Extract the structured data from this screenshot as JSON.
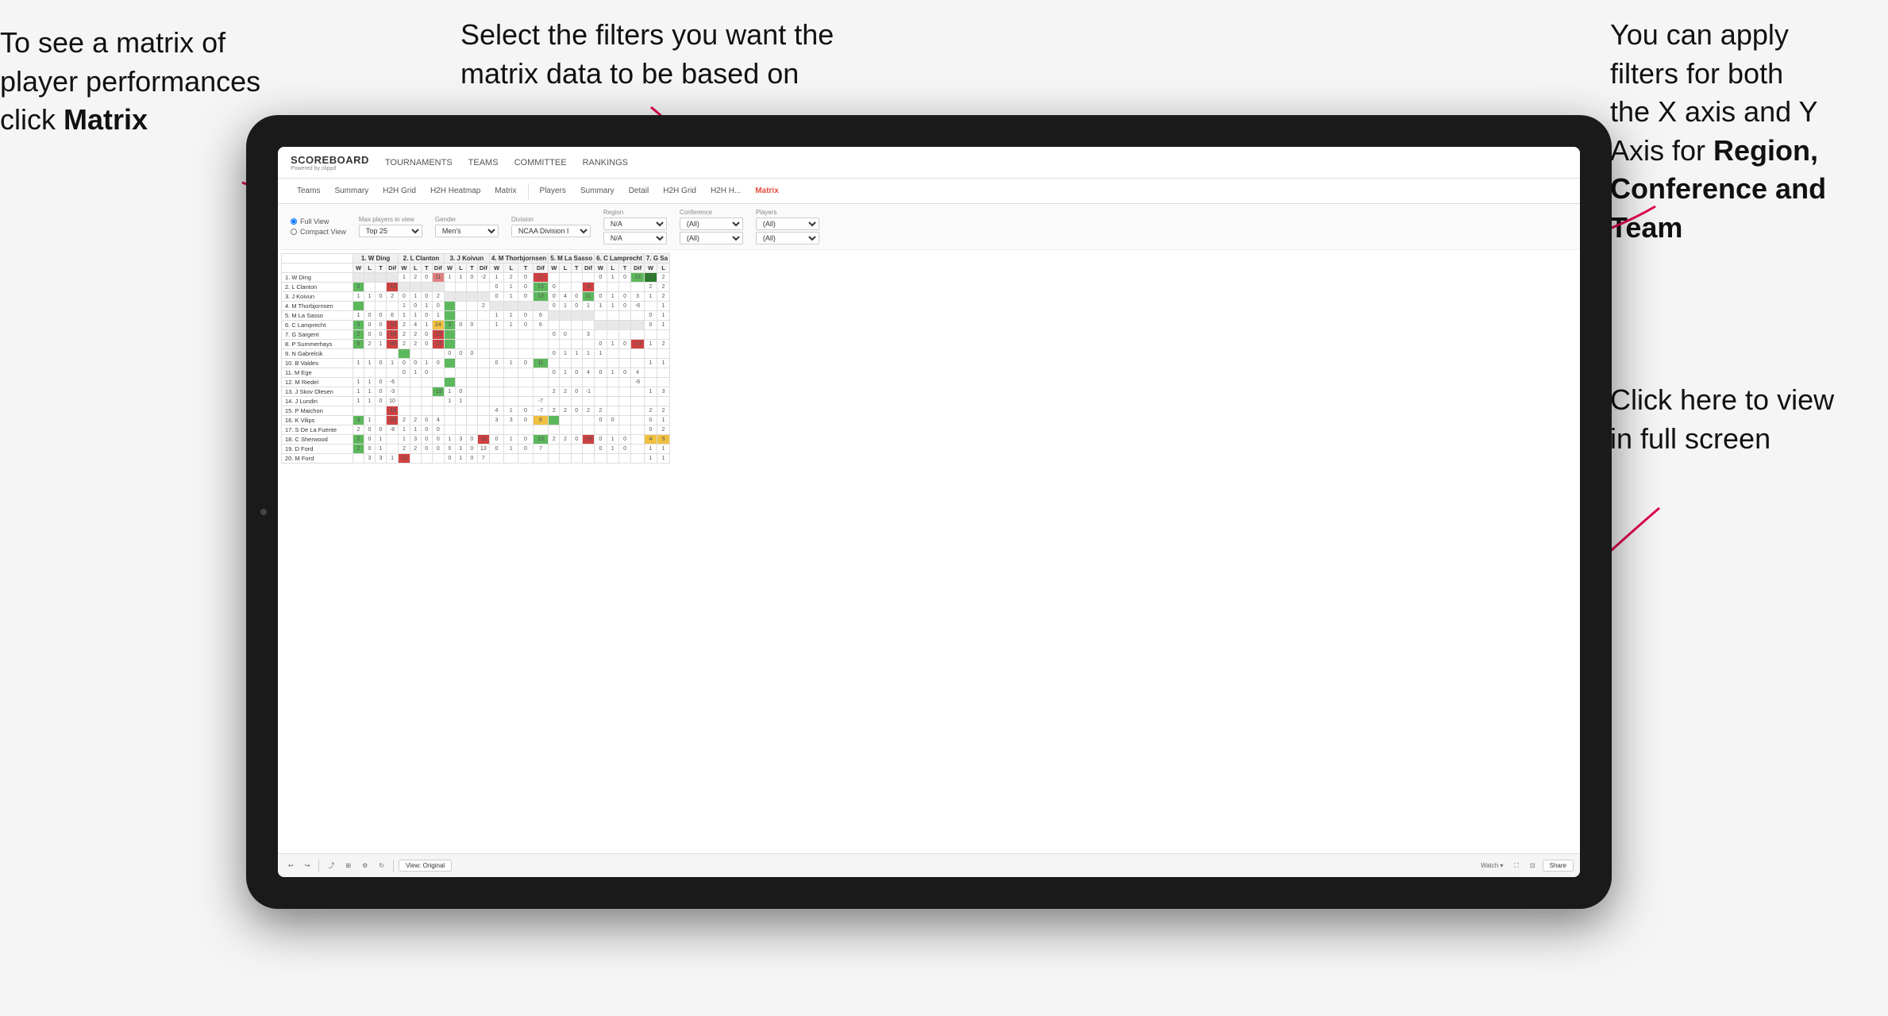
{
  "annotations": {
    "left": {
      "line1": "To see a matrix of",
      "line2": "player performances",
      "line3_prefix": "click ",
      "line3_bold": "Matrix"
    },
    "center": {
      "line1": "Select the filters you want the",
      "line2": "matrix data to be based on"
    },
    "right_top": {
      "line1": "You  can apply",
      "line2": "filters for both",
      "line3": "the X axis and Y",
      "line4_prefix": "Axis for ",
      "line4_bold": "Region,",
      "line5_bold": "Conference and",
      "line6_bold": "Team"
    },
    "right_bottom": {
      "line1": "Click here to view",
      "line2": "in full screen"
    }
  },
  "app": {
    "logo_main": "SCOREBOARD",
    "logo_sub": "Powered by clippd",
    "nav": [
      "TOURNAMENTS",
      "TEAMS",
      "COMMITTEE",
      "RANKINGS"
    ],
    "sub_nav": [
      "Teams",
      "Summary",
      "H2H Grid",
      "H2H Heatmap",
      "Matrix",
      "Players",
      "Summary",
      "Detail",
      "H2H Grid",
      "H2H H...",
      "Matrix"
    ],
    "active_tab": "Matrix"
  },
  "filters": {
    "view_options": [
      "Full View",
      "Compact View"
    ],
    "active_view": "Full View",
    "max_players_label": "Max players in view",
    "max_players_value": "Top 25",
    "gender_label": "Gender",
    "gender_value": "Men's",
    "division_label": "Division",
    "division_value": "NCAA Division I",
    "region_label": "Region",
    "region_value": "N/A",
    "region_value2": "N/A",
    "conference_label": "Conference",
    "conference_value": "(All)",
    "conference_value2": "(All)",
    "players_label": "Players",
    "players_value": "(All)",
    "players_value2": "(All)"
  },
  "matrix": {
    "col_headers": [
      "1. W Ding",
      "2. L Clanton",
      "3. J Koivun",
      "4. M Thorbjornsen",
      "5. M La Sasso",
      "6. C Lamprecht",
      "7. G Sa"
    ],
    "sub_headers": [
      "W",
      "L",
      "T",
      "Dif"
    ],
    "players": [
      "1. W Ding",
      "2. L Clanton",
      "3. J Koivun",
      "4. M Thorbjornsen",
      "5. M La Sasso",
      "6. C Lamprecht",
      "7. G Sargent",
      "8. P Summerhays",
      "9. N Gabrelcik",
      "10. B Valdes",
      "11. M Ege",
      "12. M Riedel",
      "13. J Skov Olesen",
      "14. J Lundin",
      "15. P Maichon",
      "16. K Vilips",
      "17. S De La Fuente",
      "18. C Sherwood",
      "19. D Ford",
      "20. M Ford"
    ]
  },
  "toolbar": {
    "view_original": "View: Original",
    "watch": "Watch",
    "share": "Share"
  }
}
